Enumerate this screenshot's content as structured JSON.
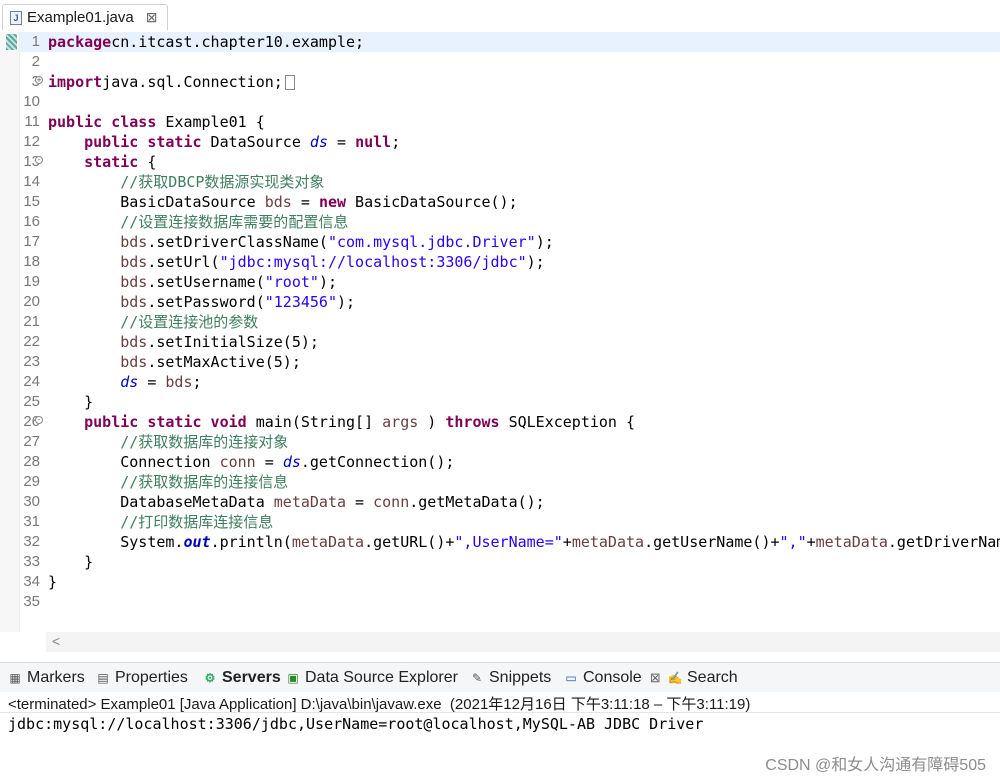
{
  "editor_tab": {
    "label": "Example01.java",
    "icon": "java-file-icon",
    "close": "⊠"
  },
  "code_lines": [
    {
      "n": "1",
      "fold": "",
      "segs": [
        [
          "kw",
          "package"
        ],
        [
          "",
          "cn.itcast.chapter10.example;"
        ]
      ]
    },
    {
      "n": "2",
      "fold": "",
      "segs": []
    },
    {
      "n": "3",
      "fold": "+",
      "segs": [
        [
          "kw",
          "import"
        ],
        [
          "",
          "java.sql.Connection;"
        ]
      ]
    },
    {
      "n": "10",
      "fold": "",
      "segs": []
    },
    {
      "n": "11",
      "fold": "",
      "segs": [
        [
          "kw",
          "public class"
        ],
        [
          "",
          " Example01 {"
        ]
      ]
    },
    {
      "n": "12",
      "fold": "",
      "segs": [
        [
          "",
          "    "
        ],
        [
          "kw",
          "public static"
        ],
        [
          "",
          " DataSource "
        ],
        [
          "fld",
          "ds"
        ],
        [
          "",
          " = "
        ],
        [
          "kw",
          "null"
        ],
        [
          "",
          ";"
        ]
      ]
    },
    {
      "n": "13",
      "fold": "-",
      "segs": [
        [
          "",
          "    "
        ],
        [
          "kw",
          "static"
        ],
        [
          "",
          " {"
        ]
      ]
    },
    {
      "n": "14",
      "fold": "",
      "segs": [
        [
          "",
          "        "
        ],
        [
          "cm",
          "//获取DBCP数据源实现类对象"
        ]
      ]
    },
    {
      "n": "15",
      "fold": "",
      "segs": [
        [
          "",
          "        BasicDataSource "
        ],
        [
          "loc",
          "bds"
        ],
        [
          "",
          " = "
        ],
        [
          "kw",
          "new"
        ],
        [
          "",
          " BasicDataSource();"
        ]
      ]
    },
    {
      "n": "16",
      "fold": "",
      "segs": [
        [
          "",
          "        "
        ],
        [
          "cm",
          "//设置连接数据库需要的配置信息"
        ]
      ]
    },
    {
      "n": "17",
      "fold": "",
      "segs": [
        [
          "",
          "        "
        ],
        [
          "loc",
          "bds"
        ],
        [
          "",
          ".setDriverClassName("
        ],
        [
          "str",
          "\"com.mysql.jdbc.Driver\""
        ],
        [
          "",
          ");"
        ]
      ]
    },
    {
      "n": "18",
      "fold": "",
      "segs": [
        [
          "",
          "        "
        ],
        [
          "loc",
          "bds"
        ],
        [
          "",
          ".setUrl("
        ],
        [
          "str",
          "\"jdbc:mysql://localhost:3306/jdbc\""
        ],
        [
          "",
          ");"
        ]
      ]
    },
    {
      "n": "19",
      "fold": "",
      "segs": [
        [
          "",
          "        "
        ],
        [
          "loc",
          "bds"
        ],
        [
          "",
          ".setUsername("
        ],
        [
          "str",
          "\"root\""
        ],
        [
          "",
          ");"
        ]
      ]
    },
    {
      "n": "20",
      "fold": "",
      "segs": [
        [
          "",
          "        "
        ],
        [
          "loc",
          "bds"
        ],
        [
          "",
          ".setPassword("
        ],
        [
          "str",
          "\"123456\""
        ],
        [
          "",
          ");"
        ]
      ]
    },
    {
      "n": "21",
      "fold": "",
      "segs": [
        [
          "",
          "        "
        ],
        [
          "cm",
          "//设置连接池的参数"
        ]
      ]
    },
    {
      "n": "22",
      "fold": "",
      "segs": [
        [
          "",
          "        "
        ],
        [
          "loc",
          "bds"
        ],
        [
          "",
          ".setInitialSize(5);"
        ]
      ]
    },
    {
      "n": "23",
      "fold": "",
      "segs": [
        [
          "",
          "        "
        ],
        [
          "loc",
          "bds"
        ],
        [
          "",
          ".setMaxActive(5);"
        ]
      ]
    },
    {
      "n": "24",
      "fold": "",
      "segs": [
        [
          "",
          "        "
        ],
        [
          "fld",
          "ds"
        ],
        [
          "",
          " = "
        ],
        [
          "loc",
          "bds"
        ],
        [
          "",
          ";"
        ]
      ]
    },
    {
      "n": "25",
      "fold": "",
      "segs": [
        [
          "",
          "    }"
        ]
      ]
    },
    {
      "n": "26",
      "fold": "-",
      "segs": [
        [
          "",
          "    "
        ],
        [
          "kw",
          "public static void"
        ],
        [
          "",
          " main(String[] "
        ],
        [
          "loc",
          "args"
        ],
        [
          "",
          " ) "
        ],
        [
          "kw",
          "throws"
        ],
        [
          "",
          " SQLException {"
        ]
      ]
    },
    {
      "n": "27",
      "fold": "",
      "segs": [
        [
          "",
          "        "
        ],
        [
          "cm",
          "//获取数据库的连接对象"
        ]
      ]
    },
    {
      "n": "28",
      "fold": "",
      "segs": [
        [
          "",
          "        Connection "
        ],
        [
          "loc",
          "conn"
        ],
        [
          "",
          " = "
        ],
        [
          "fld",
          "ds"
        ],
        [
          "",
          ".getConnection();"
        ]
      ]
    },
    {
      "n": "29",
      "fold": "",
      "segs": [
        [
          "",
          "        "
        ],
        [
          "cm",
          "//获取数据库的连接信息"
        ]
      ]
    },
    {
      "n": "30",
      "fold": "",
      "segs": [
        [
          "",
          "        DatabaseMetaData "
        ],
        [
          "loc",
          "metaData"
        ],
        [
          "",
          " = "
        ],
        [
          "loc",
          "conn"
        ],
        [
          "",
          ".getMetaData();"
        ]
      ]
    },
    {
      "n": "31",
      "fold": "",
      "segs": [
        [
          "",
          "        "
        ],
        [
          "cm",
          "//打印数据库连接信息"
        ]
      ]
    },
    {
      "n": "32",
      "fold": "",
      "segs": [
        [
          "",
          "        System."
        ],
        [
          "sfld",
          "out"
        ],
        [
          "",
          ".println("
        ],
        [
          "loc",
          "metaData"
        ],
        [
          "",
          ".getURL()+"
        ],
        [
          "str",
          "\",UserName=\""
        ],
        [
          "",
          "+"
        ],
        [
          "loc",
          "metaData"
        ],
        [
          "",
          ".getUserName()+"
        ],
        [
          "str",
          "\",\""
        ],
        [
          "",
          "+"
        ],
        [
          "loc",
          "metaData"
        ],
        [
          "",
          ".getDriverName"
        ]
      ]
    },
    {
      "n": "33",
      "fold": "",
      "segs": [
        [
          "",
          "    }"
        ]
      ]
    },
    {
      "n": "34",
      "fold": "",
      "segs": [
        [
          "",
          "}"
        ]
      ]
    },
    {
      "n": "35",
      "fold": "",
      "segs": []
    }
  ],
  "scroll_arrow": "<",
  "view_tabs": [
    {
      "label": "Markers",
      "icon": "markers-icon",
      "glyph": "▦",
      "color": "#555"
    },
    {
      "label": "Properties",
      "icon": "properties-icon",
      "glyph": "▤",
      "color": "#555"
    },
    {
      "label": "Servers",
      "icon": "servers-icon",
      "glyph": "⚙",
      "color": "#3a6"
    },
    {
      "label": "Data Source Explorer",
      "icon": "data-source-explorer-icon",
      "glyph": "▣",
      "color": "#2a8a2a"
    },
    {
      "label": "Snippets",
      "icon": "snippets-icon",
      "glyph": "✎",
      "color": "#555"
    },
    {
      "label": "Console",
      "icon": "console-icon",
      "glyph": "▭",
      "color": "#2b5fa8"
    },
    {
      "label": "Search",
      "icon": "search-icon",
      "glyph": "✍",
      "color": "#c68a1a"
    }
  ],
  "console": {
    "status": "<terminated> Example01 [Java Application] D:\\java\\bin\\javaw.exe  (2021年12月16日 下午3:11:18 – 下午3:11:19)",
    "output": "jdbc:mysql://localhost:3306/jdbc,UserName=root@localhost,MySQL-AB JDBC Driver",
    "close": "⊠"
  },
  "watermark": "CSDN @和女人沟通有障碍505"
}
